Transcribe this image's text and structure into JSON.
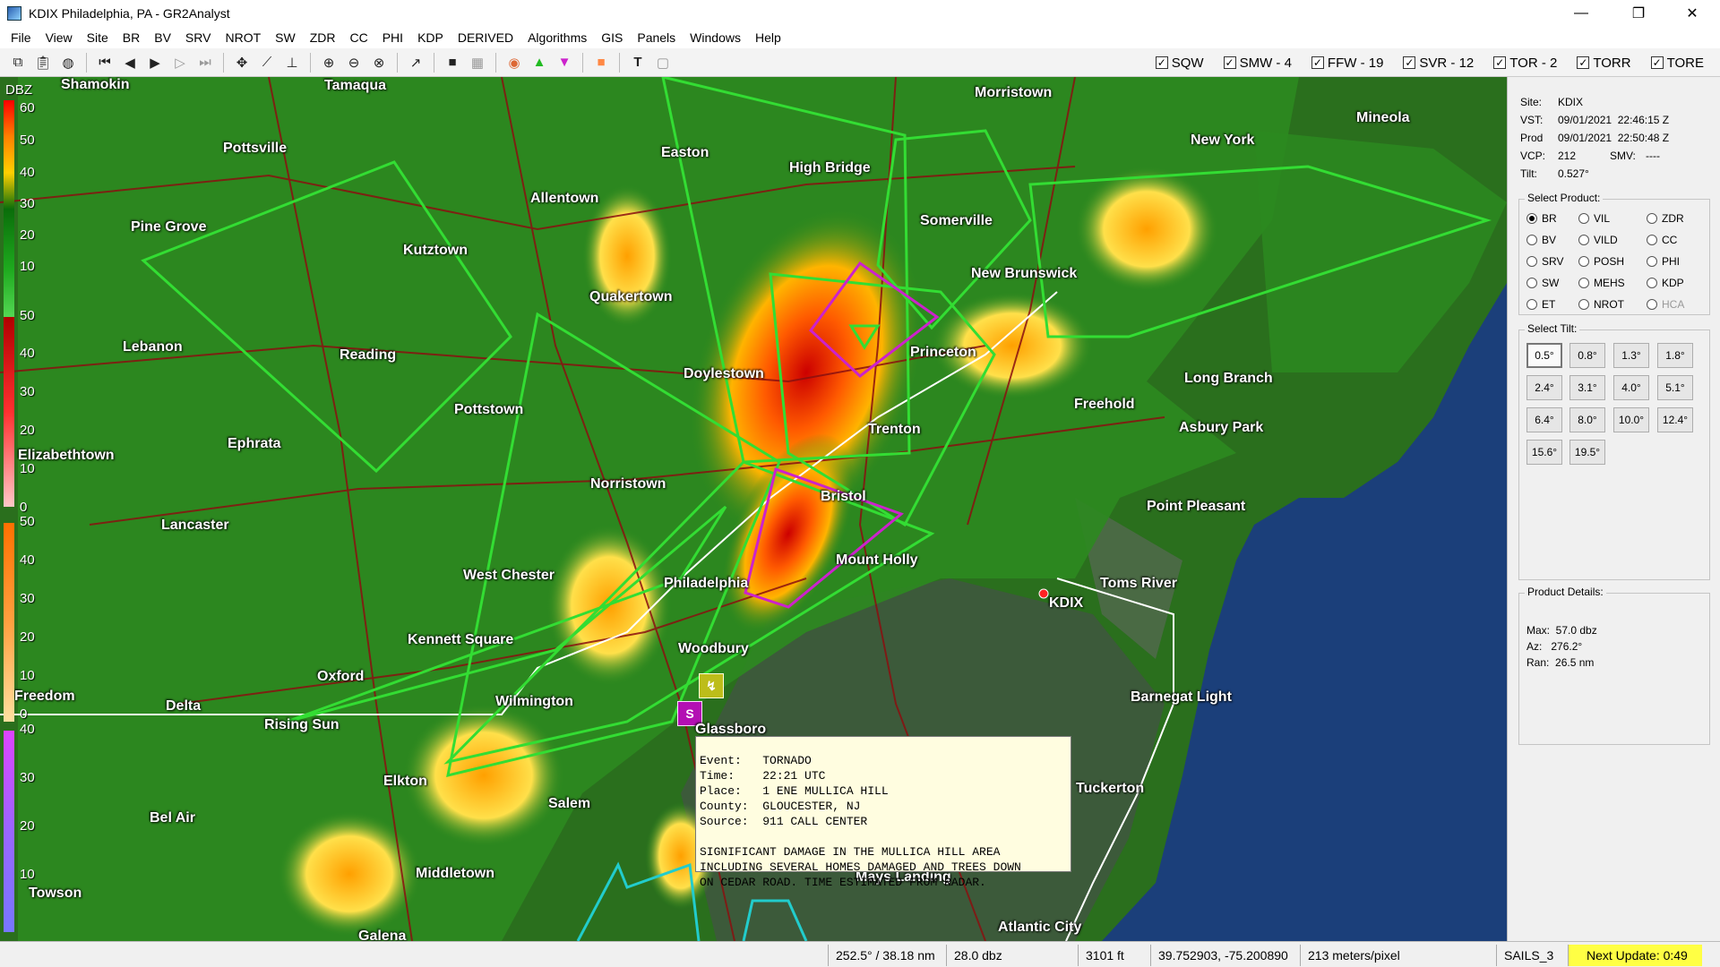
{
  "window": {
    "title": "KDIX Philadelphia, PA - GR2Analyst",
    "minimize_glyph": "—",
    "maximize_glyph": "❐",
    "close_glyph": "✕"
  },
  "menu": [
    "File",
    "View",
    "Site",
    "BR",
    "BV",
    "SRV",
    "NROT",
    "SW",
    "ZDR",
    "CC",
    "PHI",
    "KDP",
    "DERIVED",
    "Algorithms",
    "GIS",
    "Panels",
    "Windows",
    "Help"
  ],
  "toolbar": {
    "tools": [
      "copy-icon",
      "paste-icon",
      "globe-icon",
      "skip-first-icon",
      "step-back-icon",
      "play-icon",
      "step-forward-icon",
      "skip-last-icon",
      "pan-icon",
      "measure-icon",
      "cross-section-icon",
      "zoom-in-icon",
      "zoom-out-icon",
      "zoom-reset-icon",
      "arrow-icon",
      "stop-icon",
      "grid-icon",
      "storm-icon",
      "green-triangle-icon",
      "magenta-triangle-icon",
      "color-icon",
      "text-icon",
      "square-icon"
    ],
    "warning_toggles": [
      {
        "label": "SQW",
        "checked": true
      },
      {
        "label": "SMW - 4",
        "checked": true
      },
      {
        "label": "FFW - 19",
        "checked": true
      },
      {
        "label": "SVR - 12",
        "checked": true
      },
      {
        "label": "TOR - 2",
        "checked": true
      },
      {
        "label": "TORR",
        "checked": true
      },
      {
        "label": "TORE",
        "checked": true
      }
    ]
  },
  "colorbar": {
    "unit": "DBZ",
    "labels": [
      "60",
      "50",
      "40",
      "30",
      "20",
      "10",
      "50",
      "40",
      "30",
      "20",
      "10",
      "0",
      "50",
      "40",
      "30",
      "20",
      "10",
      "0",
      "40",
      "30",
      "20",
      "10"
    ]
  },
  "map": {
    "cities": [
      "Shamokin",
      "Tamaqua",
      "Morristown",
      "Mineola",
      "Pottsville",
      "Easton",
      "New York",
      "High Bridge",
      "Allentown",
      "Somerville",
      "Pine Grove",
      "Kutztown",
      "New Brunswick",
      "Quakertown",
      "Lebanon",
      "Reading",
      "Princeton",
      "Doylestown",
      "Long Branch",
      "Freehold",
      "Trenton",
      "Asbury Park",
      "Ephrata",
      "Elizabethtown",
      "Norristown",
      "Bristol",
      "Point Pleasant",
      "Lancaster",
      "Mount Holly",
      "West Chester",
      "Toms River",
      "Philadelphia",
      "KDIX",
      "Kennett Square",
      "Woodbury",
      "Oxford",
      "Barnegat Light",
      "Wilmington",
      "Delta",
      "Freedom",
      "Rising Sun",
      "Glassboro",
      "Elkton",
      "Salem",
      "Bel Air",
      "Middletown",
      "Mays Landing",
      "Towson",
      "Atlantic City",
      "Galena",
      "Pottstown",
      "Tuckerton"
    ],
    "storm_report": {
      "event": "TORNADO",
      "time": "22:21 UTC",
      "place": "1 ENE MULLICA HILL",
      "county": "GLOUCESTER, NJ",
      "source": "911 CALL CENTER",
      "remarks": "SIGNIFICANT DAMAGE IN THE MULLICA HILL AREA\nINCLUDING SEVERAL HOMES DAMAGED AND TREES DOWN\nON CEDAR ROAD. TIME ESTIMATED FROM RADAR."
    }
  },
  "site_info": {
    "site_label": "Site:",
    "site": "KDIX",
    "vst_label": "VST:",
    "vst": "09/01/2021  22:46:15 Z",
    "prod_label": "Prod",
    "prod": "09/01/2021  22:50:48 Z",
    "vcp_label": "VCP:",
    "vcp": "212",
    "smv_label": "SMV:",
    "smv": "----",
    "tilt_label": "Tilt:",
    "tilt": "0.527°"
  },
  "select_product": {
    "title": "Select Product:",
    "options": [
      {
        "label": "BR",
        "selected": true,
        "enabled": true
      },
      {
        "label": "VIL",
        "selected": false,
        "enabled": true
      },
      {
        "label": "ZDR",
        "selected": false,
        "enabled": true
      },
      {
        "label": "BV",
        "selected": false,
        "enabled": true
      },
      {
        "label": "VILD",
        "selected": false,
        "enabled": true
      },
      {
        "label": "CC",
        "selected": false,
        "enabled": true
      },
      {
        "label": "SRV",
        "selected": false,
        "enabled": true
      },
      {
        "label": "POSH",
        "selected": false,
        "enabled": true
      },
      {
        "label": "PHI",
        "selected": false,
        "enabled": true
      },
      {
        "label": "SW",
        "selected": false,
        "enabled": true
      },
      {
        "label": "MEHS",
        "selected": false,
        "enabled": true
      },
      {
        "label": "KDP",
        "selected": false,
        "enabled": true
      },
      {
        "label": "ET",
        "selected": false,
        "enabled": true
      },
      {
        "label": "NROT",
        "selected": false,
        "enabled": true
      },
      {
        "label": "HCA",
        "selected": false,
        "enabled": false
      }
    ]
  },
  "select_tilt": {
    "title": "Select Tilt:",
    "tilts": [
      "0.5°",
      "0.8°",
      "1.3°",
      "1.8°",
      "2.4°",
      "3.1°",
      "4.0°",
      "5.1°",
      "6.4°",
      "8.0°",
      "10.0°",
      "12.4°",
      "15.6°",
      "19.5°"
    ],
    "active_index": 0
  },
  "product_details": {
    "title": "Product Details:",
    "max": "Max:  57.0 dbz",
    "az": "Az:   276.2°",
    "ran": "Ran:  26.5 nm"
  },
  "status": {
    "az_range": "252.5° / 38.18 nm",
    "value": "28.0 dbz",
    "height": "3101 ft",
    "latlon": "39.752903, -75.200890",
    "resolution": "213 meters/pixel",
    "mode": "SAILS_3",
    "next_update": "Next Update: 0:49"
  },
  "colors": {
    "accent_yellow": "#ffff44",
    "warning_green": "#33dd33",
    "tornado_magenta": "#cc22cc",
    "flood_cyan": "#22cccc",
    "land": "#2a6f1d",
    "ocean": "#1b3f7a"
  }
}
